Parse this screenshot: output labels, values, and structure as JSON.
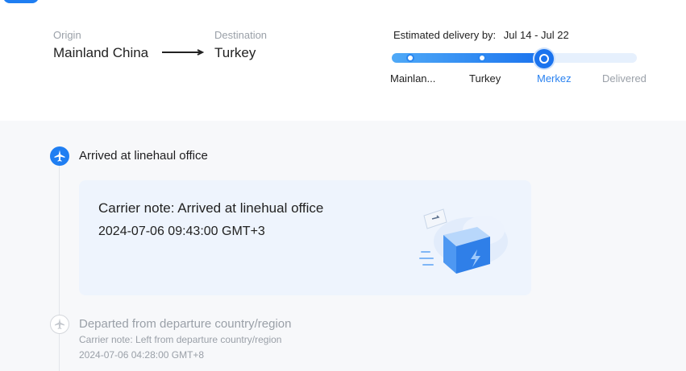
{
  "route": {
    "origin_label": "Origin",
    "origin_value": "Mainland China",
    "destination_label": "Destination",
    "destination_value": "Turkey"
  },
  "estimate": {
    "label": "Estimated delivery by:",
    "range": "Jul 14 - Jul 22"
  },
  "progress": {
    "fraction": 0.62,
    "stages": [
      {
        "label": "Mainlan...",
        "state": "done"
      },
      {
        "label": "Turkey",
        "state": "done"
      },
      {
        "label": "Merkez",
        "state": "current"
      },
      {
        "label": "Delivered",
        "state": "future"
      }
    ]
  },
  "events": [
    {
      "title": "Arrived at linehaul office",
      "note": "Carrier note: Arrived at linehual office",
      "time": "2024-07-06 09:43:00 GMT+3",
      "icon": "plane-icon",
      "state": "current"
    },
    {
      "title": "Departed from departure country/region",
      "note": "Carrier note: Left from departure country/region",
      "time": "2024-07-06 04:28:00 GMT+8",
      "icon": "plane-icon",
      "state": "past"
    }
  ],
  "colors": {
    "accent": "#1f7ef2",
    "muted": "#9aa0a8",
    "card": "#eef4fd"
  }
}
